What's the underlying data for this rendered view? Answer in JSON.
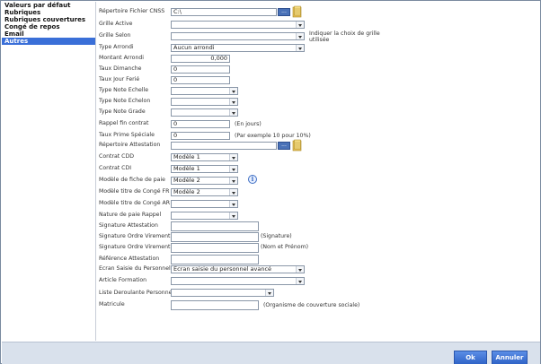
{
  "sidebar": {
    "items": [
      {
        "label": "Valeurs par défaut"
      },
      {
        "label": "Rubriques"
      },
      {
        "label": "Rubriques couvertures"
      },
      {
        "label": "Congé de repos"
      },
      {
        "label": "Email"
      },
      {
        "label": "Autres"
      }
    ],
    "active_index": 5
  },
  "form": {
    "repertoire_cnss": {
      "label": "Répertoire Fichier CNSS",
      "value": "C:\\",
      "browse": "..."
    },
    "grille_active": {
      "label": "Grille Active",
      "value": ""
    },
    "grille_selon": {
      "label": "Grille Selon",
      "value": "",
      "hint": "Indiquer la choix de grille utilisée"
    },
    "type_arrondi": {
      "label": "Type Arrondi",
      "value": "Aucun arrondi"
    },
    "montant_arrondi": {
      "label": "Montant Arrondi",
      "value": "0,000"
    },
    "taux_dimanche": {
      "label": "Taux Dimanche",
      "value": "0"
    },
    "taux_jour_ferie": {
      "label": "Taux Jour Ferié",
      "value": "0"
    },
    "type_note_echelle": {
      "label": "Type Note Echelle",
      "value": ""
    },
    "type_note_echelon": {
      "label": "Type Note Echelon",
      "value": ""
    },
    "type_note_grade": {
      "label": "Type Note Grade",
      "value": ""
    },
    "rappel_fin_contrat": {
      "label": "Rappel fin contrat",
      "value": "0",
      "hint": "(En jours)"
    },
    "taux_prime_speciale": {
      "label": "Taux Prime Spéciale",
      "value": "0",
      "hint": "(Par exemple 10 pour 10%)"
    },
    "repertoire_attestation": {
      "label": "Répertoire Attestation",
      "value": "",
      "browse": "..."
    },
    "contrat_cdd": {
      "label": "Contrat CDD",
      "value": "Modèle 1"
    },
    "contrat_cdi": {
      "label": "Contrat CDI",
      "value": "Modèle 1"
    },
    "modele_fiche_paie": {
      "label": "Modèle de fiche de paie",
      "value": "Modèle 2"
    },
    "modele_conge_fr": {
      "label": "Modèle titre de Congé FR",
      "value": "Modèle 2"
    },
    "modele_conge_ar": {
      "label": "Modèle titre de Congé AR",
      "value": ""
    },
    "nature_paie_rappel": {
      "label": "Nature de paie Rappel",
      "value": ""
    },
    "signature_attestation": {
      "label": "Signature Attestation",
      "value": ""
    },
    "signature_ordre_virement_1": {
      "label": "Signature Ordre Virement",
      "value": "",
      "hint": "(Signature)"
    },
    "signature_ordre_virement_2": {
      "label": "Signature Ordre Virement",
      "value": "",
      "hint": "(Nom et Prénom)"
    },
    "reference_attestation": {
      "label": "Référence Attestation",
      "value": ""
    },
    "ecran_saisie": {
      "label": "Ecran Saisie du Personnel",
      "value": "Ecran saisie du personnel avancé"
    },
    "article_formation": {
      "label": "Article Formation",
      "value": ""
    },
    "liste_deroulante": {
      "label": "Liste Deroulante Personne",
      "value": ""
    },
    "matricule": {
      "label": "Matricule",
      "value": "",
      "hint": "(Organisme de couverture sociale)"
    }
  },
  "footer": {
    "ok_label": "Ok",
    "cancel_label": "Annuler"
  },
  "icons": {
    "folder": "folder-icon",
    "info": "info-icon",
    "dropdown": "chevron-down-icon"
  }
}
